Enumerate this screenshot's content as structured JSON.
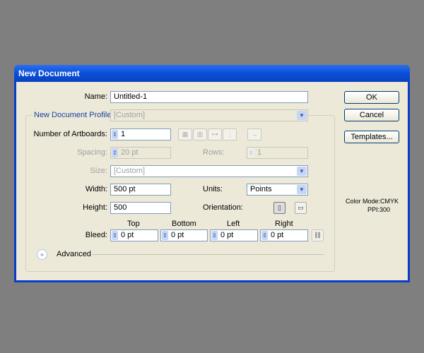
{
  "window": {
    "title": "New Document"
  },
  "name": {
    "label": "Name:",
    "value": "Untitled-1"
  },
  "profile": {
    "label": "New Document Profile:",
    "value": "[Custom]"
  },
  "artboards": {
    "label": "Number of Artboards:",
    "value": "1",
    "arrange_icons": [
      "grid-by-row-icon",
      "grid-by-column-icon",
      "arrange-by-row-icon",
      "arrange-by-column-icon"
    ],
    "direction_icon": "right-arrow-icon"
  },
  "spacing": {
    "label": "Spacing:",
    "value": "20 pt"
  },
  "rows": {
    "label": "Rows:",
    "value": "1"
  },
  "size": {
    "label": "Size:",
    "value": "[Custom]"
  },
  "width": {
    "label": "Width:",
    "value": "500 pt"
  },
  "units": {
    "label": "Units:",
    "value": "Points"
  },
  "height": {
    "label": "Height:",
    "value": "500"
  },
  "orientation": {
    "label": "Orientation:",
    "selected": "portrait"
  },
  "bleed": {
    "label": "Bleed:",
    "headers": [
      "Top",
      "Bottom",
      "Left",
      "Right"
    ],
    "values": [
      "0 pt",
      "0 pt",
      "0 pt",
      "0 pt"
    ]
  },
  "advanced": {
    "label": "Advanced"
  },
  "buttons": {
    "ok": "OK",
    "cancel": "Cancel",
    "templates": "Templates..."
  },
  "info": {
    "color_mode": "Color Mode:CMYK",
    "ppi": "PPI:300"
  }
}
